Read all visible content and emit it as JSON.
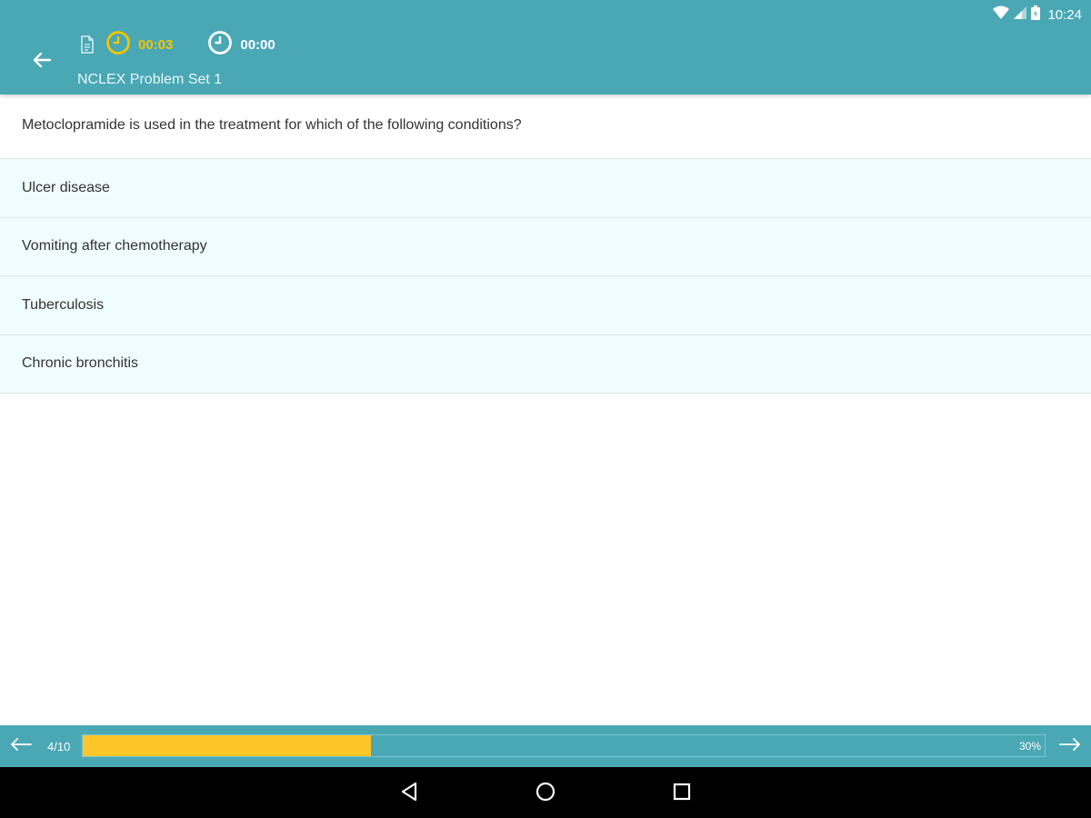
{
  "status_bar": {
    "time": "10:24",
    "icons": [
      "wifi-icon",
      "cell-signal-icon",
      "battery-icon"
    ]
  },
  "header": {
    "back_icon": "arrow-left-icon",
    "document_icon": "document-icon",
    "elapsed_timer": {
      "value": "00:03",
      "icon": "clock-icon",
      "color": "#f5c400"
    },
    "total_timer": {
      "value": "00:00",
      "icon": "clock-icon",
      "color": "#ffffff"
    },
    "set_title": "NCLEX Problem Set 1",
    "background_color": "#4aa8b5"
  },
  "question": {
    "text": "Metoclopramide is used in the treatment for which of the following conditions?",
    "options": [
      {
        "label": "Ulcer disease"
      },
      {
        "label": "Vomiting after chemotherapy"
      },
      {
        "label": "Tuberculosis"
      },
      {
        "label": "Chronic bronchitis"
      }
    ]
  },
  "progress": {
    "position_label": "4/10",
    "percent_label": "30%",
    "fill_fraction": 0.3,
    "fill_color": "#fcc52a",
    "prev_icon": "arrow-left-icon",
    "next_icon": "arrow-right-icon"
  },
  "nav_bar": {
    "back_icon": "nav-back-icon",
    "home_icon": "nav-home-icon",
    "recents_icon": "nav-recents-icon"
  }
}
